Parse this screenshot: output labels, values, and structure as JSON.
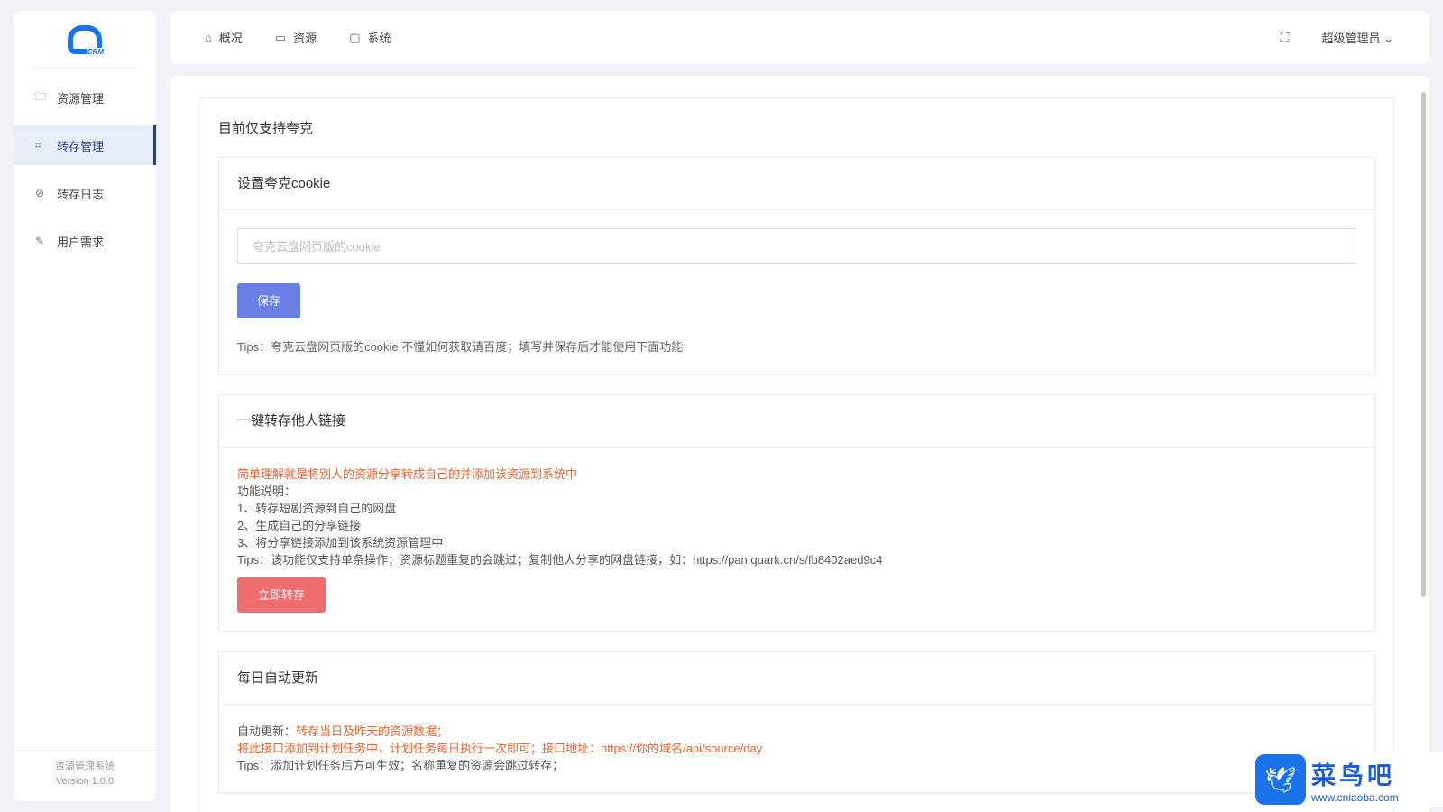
{
  "sidebar": {
    "logo_text": "CRM",
    "items": [
      {
        "label": "资源管理",
        "icon": "folder-icon"
      },
      {
        "label": "转存管理",
        "icon": "crop-icon",
        "active": true
      },
      {
        "label": "转存日志",
        "icon": "compass-icon"
      },
      {
        "label": "用户需求",
        "icon": "pen-icon"
      }
    ],
    "footer_name": "资源管理系统",
    "footer_version": "Version 1.0.0"
  },
  "topbar": {
    "tabs": [
      {
        "label": "概况",
        "icon": "home-icon"
      },
      {
        "label": "资源",
        "icon": "box-icon"
      },
      {
        "label": "系统",
        "icon": "monitor-icon"
      }
    ],
    "user": "超级管理员"
  },
  "main": {
    "title": "目前仅支持夸克",
    "cookie": {
      "title": "设置夸克cookie",
      "placeholder": "夸克云盘网页版的cookie",
      "save": "保存",
      "tips": "Tips：夸克云盘网页版的cookie,不懂如何获取请百度；填写并保存后才能使用下面功能"
    },
    "transfer": {
      "title": "一键转存他人链接",
      "intro": "简单理解就是将别人的资源分享转成自己的并添加该资源到系统中",
      "desc_label": "功能说明：",
      "steps": [
        "1、转存短剧资源到自己的网盘",
        "2、生成自己的分享链接",
        "3、将分享链接添加到该系统资源管理中"
      ],
      "tips": "Tips：该功能仅支持单条操作；资源标题重复的会跳过；复制他人分享的网盘链接，如：https://pan.quark.cn/s/fb8402aed9c4",
      "button": "立即转存"
    },
    "daily": {
      "title": "每日自动更新",
      "label": "自动更新：",
      "label_value": "转存当日及昨天的资源数据；",
      "api_line": "将此接口添加到计划任务中，计划任务每日执行一次即可；接口地址：https://你的域名/api/source/day",
      "tips": "Tips：添加计划任务后方可生效；名称重复的资源会跳过转存；"
    }
  },
  "watermark": {
    "name": "菜鸟吧",
    "url": "www.cniaoba.com"
  },
  "colors": {
    "accent": "#2a3c7a",
    "save": "#6a7fe6",
    "danger": "#ee6d6d",
    "highlight": "#e8642f"
  }
}
